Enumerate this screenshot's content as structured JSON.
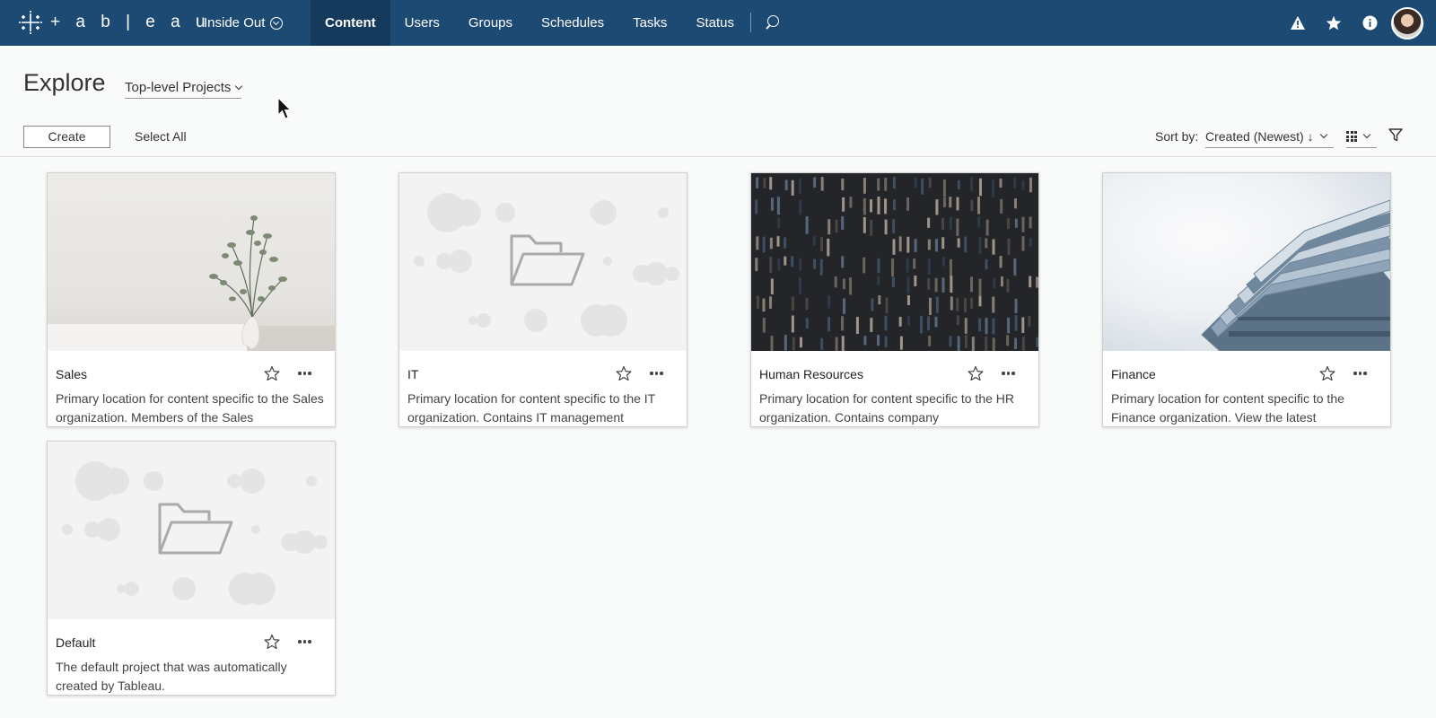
{
  "app": {
    "logo_text": "+ a b | e a u",
    "site_name": "Inside Out"
  },
  "nav": {
    "items": [
      {
        "label": "Content",
        "active": true
      },
      {
        "label": "Users",
        "active": false
      },
      {
        "label": "Groups",
        "active": false
      },
      {
        "label": "Schedules",
        "active": false
      },
      {
        "label": "Tasks",
        "active": false
      },
      {
        "label": "Status",
        "active": false
      }
    ],
    "right_icons": [
      "warning-icon",
      "star-icon",
      "info-icon",
      "avatar"
    ]
  },
  "page": {
    "title": "Explore",
    "project_filter": "Top-level Projects"
  },
  "toolbar": {
    "create_label": "Create",
    "select_all_label": "Select All",
    "sort_label": "Sort by:",
    "sort_value": "Created (Newest) ↓"
  },
  "cards": [
    {
      "title": "Sales",
      "description": "Primary location for content specific to the Sales organization. Members of the Sales",
      "thumbnail": "plant-photo"
    },
    {
      "title": "IT",
      "description": "Primary location for content specific to the IT organization. Contains IT management",
      "thumbnail": "folder-placeholder"
    },
    {
      "title": "Human Resources",
      "description": "Primary location for content specific to the HR organization. Contains company",
      "thumbnail": "dark-pattern-photo"
    },
    {
      "title": "Finance",
      "description": "Primary location for content specific to the Finance organization. View the latest",
      "thumbnail": "folders-stack-photo"
    },
    {
      "title": "Default",
      "description": "The default project that was automatically created by Tableau.",
      "thumbnail": "folder-placeholder"
    }
  ],
  "colors": {
    "nav_bg": "#1d4a72",
    "nav_active_bg": "#163a5b",
    "page_bg": "#f9fafa"
  }
}
